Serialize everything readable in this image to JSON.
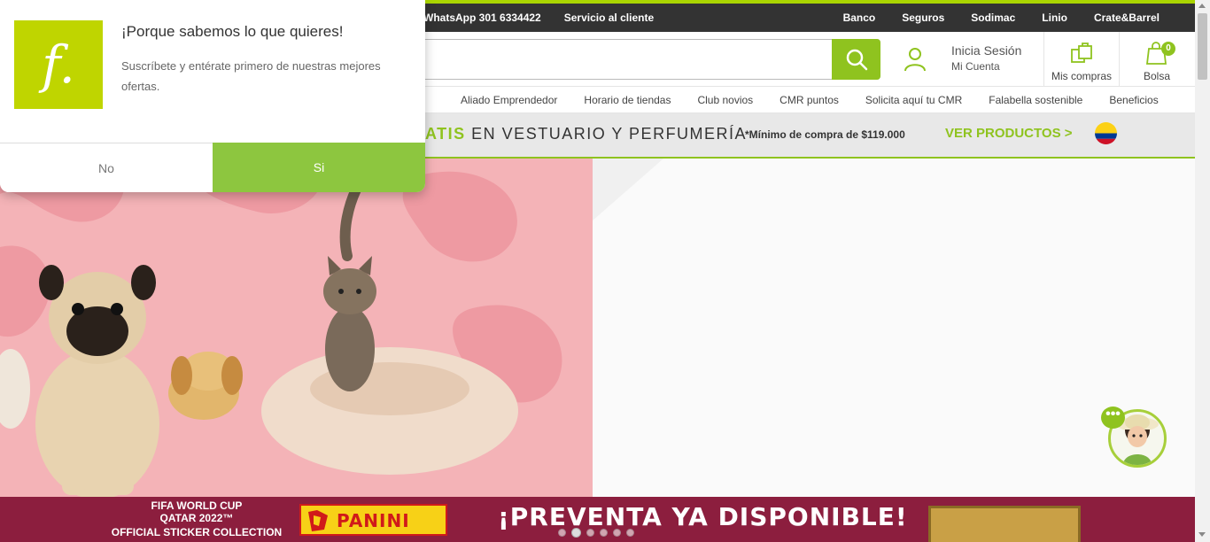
{
  "topbar": {
    "whatsapp": "WhatsApp 301 6334422",
    "servicio": "Servicio al cliente",
    "links": [
      "Banco",
      "Seguros",
      "Sodimac",
      "Linio",
      "Crate&Barrel"
    ]
  },
  "search": {
    "placeholder": "",
    "icon": "search-icon"
  },
  "account": {
    "line1": "Inicia Sesión",
    "line2": "Mi Cuenta"
  },
  "mis_compras": "Mis compras",
  "bolsa": {
    "label": "Bolsa",
    "count": "0"
  },
  "nav": [
    "Aliado Emprendedor",
    "Horario de tiendas",
    "Club novios",
    "CMR puntos",
    "Solicita aquí tu CMR",
    "Falabella sostenible",
    "Beneficios"
  ],
  "promo": {
    "highlight": "ATIS",
    "text": " EN VESTUARIO Y PERFUMERÍA",
    "min": "*Mínimo de compra de $119.000",
    "cta": "VER PRODUCTOS >"
  },
  "banner": {
    "fifa_line1": "FIFA WORLD CUP",
    "fifa_line2": "QATAR 2022™",
    "fifa_line3": "OFFICIAL STICKER COLLECTION",
    "panini": "PANINI",
    "headline": "¡PREVENTA YA DISPONIBLE!"
  },
  "popup": {
    "logo": "f.",
    "title": "¡Porque sabemos lo que quieres!",
    "body": "Suscríbete y entérate primero de nuestras mejores ofertas.",
    "no": "No",
    "si": "Si"
  },
  "colors": {
    "brand_green": "#8fc31f",
    "topbar": "#333333",
    "banner": "#8c1e3e",
    "hero_pink": "#f4b3b7"
  }
}
